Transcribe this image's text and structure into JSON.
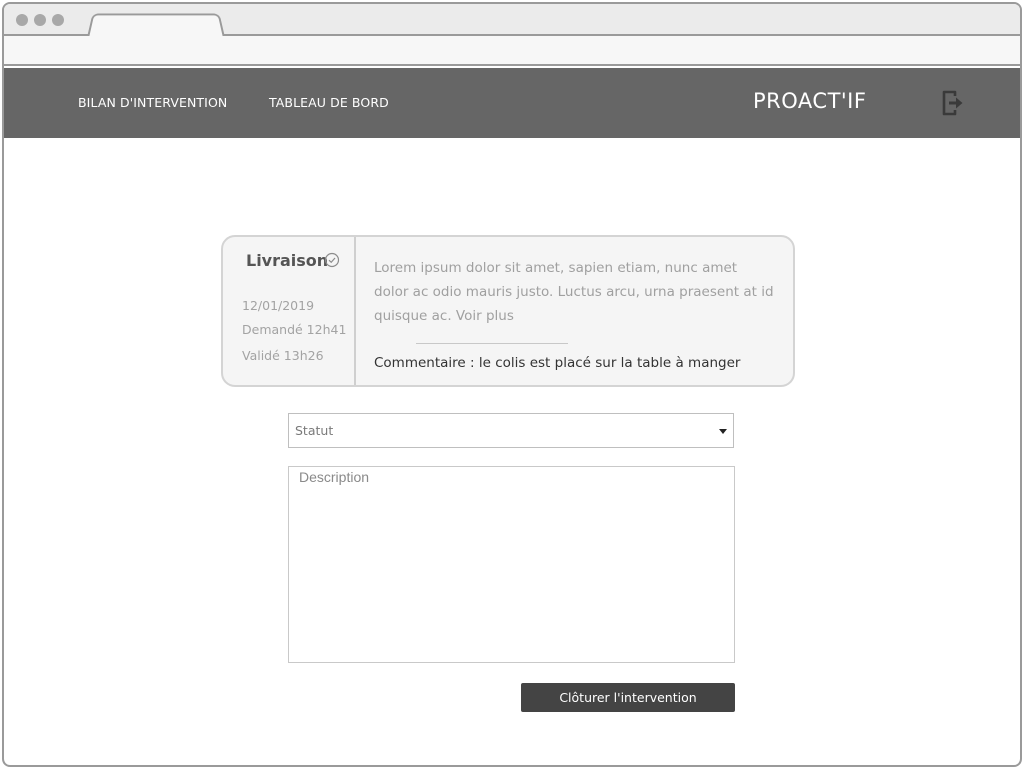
{
  "browser": {
    "controls": [
      "close-dot",
      "minimize-dot",
      "maximize-dot"
    ],
    "tab_title": "",
    "address": ""
  },
  "nav": {
    "links": [
      {
        "label": "BILAN D'INTERVENTION"
      },
      {
        "label": "TABLEAU DE BORD"
      }
    ],
    "brand": "PROACT'IF",
    "logout_icon": "logout-icon"
  },
  "card": {
    "title": "Livraison",
    "status_icon": "check-circle-icon",
    "date": "12/01/2019",
    "requested": "Demandé 12h41",
    "validated": "Validé 13h26",
    "description": "Lorem ipsum dolor sit amet, sapien etiam, nunc amet dolor ac odio mauris justo. Luctus arcu, urna praesent at id quisque ac. Voir plus",
    "comment": "Commentaire : le colis est placé sur la table à manger"
  },
  "form": {
    "status_select": {
      "selected": "Statut"
    },
    "description_placeholder": "Description",
    "submit_label": "Clôturer l'intervention"
  },
  "colors": {
    "navbar": "#666666",
    "button": "#444444",
    "card_background": "#f5f5f5"
  }
}
